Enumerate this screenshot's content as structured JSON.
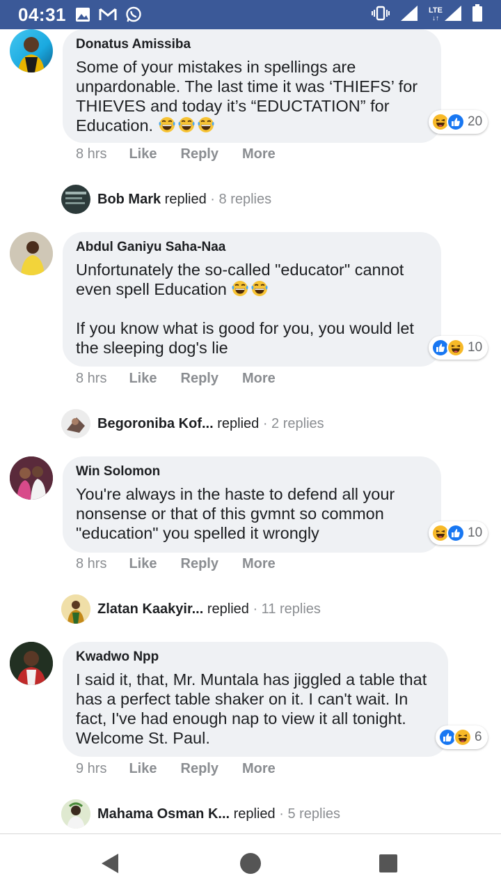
{
  "status_bar": {
    "time": "04:31",
    "network_label": "LTE",
    "left_icons": [
      "gallery-icon",
      "gmail-icon",
      "whatsapp-icon"
    ],
    "right_icons": [
      "vibrate-icon",
      "signal-icon",
      "battery-icon"
    ]
  },
  "colors": {
    "status_bar": "#3b5998",
    "bubble": "#eff1f4",
    "muted_text": "#8a8d91",
    "like_blue": "#1877f2",
    "haha_yellow": "#f7b928"
  },
  "actions": {
    "like": "Like",
    "reply": "Reply",
    "more": "More"
  },
  "comments": [
    {
      "author": "Donatus Amissiba",
      "text": "Some of your mistakes in spellings are unpardonable. The last time it was ‘THIEFS’ for THIEVES and today it’s “EDUCTATION” for Education.",
      "emoji_count": 3,
      "reaction_count": "20",
      "reactions": [
        "haha",
        "like"
      ],
      "time": "8 hrs",
      "replied_by": "Bob Mark",
      "replied_word": " replied",
      "replies": " · 8 replies"
    },
    {
      "author": "Abdul Ganiyu Saha-Naa",
      "text": "Unfortunately the so-called \"educator\" cannot even spell Education",
      "text2": "If you know what is good for you, you would let the sleeping dog's lie",
      "emoji_count": 2,
      "reaction_count": "10",
      "reactions": [
        "like",
        "haha"
      ],
      "time": "8 hrs",
      "replied_by": "Begoroniba Kof...",
      "replied_word": " replied",
      "replies": " · 2 replies"
    },
    {
      "author": "Win Solomon",
      "text": "You're always in the haste to defend all your nonsense or that of this gvmnt so common \"education\" you spelled it wrongly",
      "reaction_count": "10",
      "reactions": [
        "haha",
        "like"
      ],
      "time": "8 hrs",
      "replied_by": "Zlatan Kaakyir...",
      "replied_word": " replied",
      "replies": " · 11 replies"
    },
    {
      "author": "Kwadwo Npp",
      "text": "I said it, that, Mr. Muntala has jiggled a table that has a perfect table shaker on it. I can't wait. In fact, I've had enough nap to view it all tonight. Welcome St. Paul.",
      "reaction_count": "6",
      "reactions": [
        "like",
        "haha"
      ],
      "time": "9 hrs",
      "replied_by": "Mahama Osman K...",
      "replied_word": " replied",
      "replies": " · 5 replies"
    }
  ],
  "nav": [
    "back-icon",
    "home-icon",
    "recents-icon"
  ]
}
